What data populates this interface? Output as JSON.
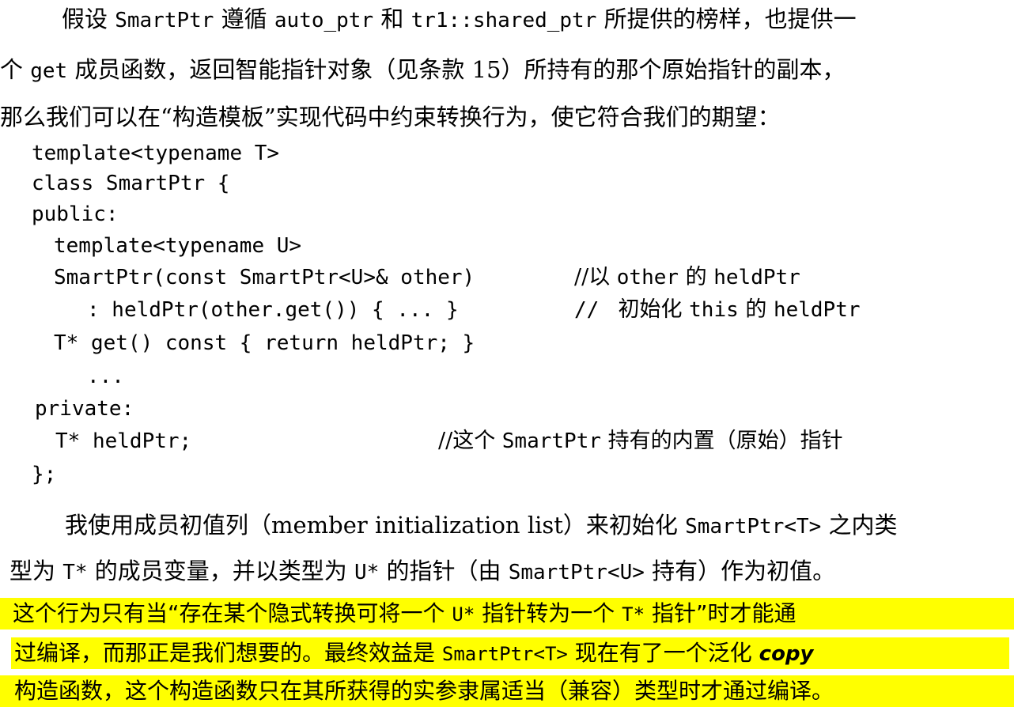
{
  "para1": {
    "l1_a": "假设 ",
    "l1_b": "SmartPtr",
    "l1_c": " 遵循 ",
    "l1_d": "auto_ptr",
    "l1_e": " 和 ",
    "l1_f": "tr1::shared_ptr",
    "l1_g": " 所提供的榜样，也提供一",
    "l2_a": "个 ",
    "l2_b": "get",
    "l2_c": " 成员函数，返回智能指针对象（见条款 15）所持有的那个原始指针的副本，",
    "l3": "那么我们可以在“构造模板”实现代码中约束转换行为，使它符合我们的期望："
  },
  "code": {
    "c1": "template<typename T>",
    "c2": "class SmartPtr {",
    "c3": "public:",
    "c4": "template<typename U>",
    "c5": "SmartPtr(const SmartPtr<U>& other)",
    "c5_cmt_a": "//以 ",
    "c5_cmt_b": "other",
    "c5_cmt_c": " 的 ",
    "c5_cmt_d": "heldPtr",
    "c6": ": heldPtr(other.get()) { ... }",
    "c6_cmt_a": "// ",
    "c6_cmt_b": " 初始化 ",
    "c6_cmt_c": "this",
    "c6_cmt_d": " 的 ",
    "c6_cmt_e": "heldPtr",
    "c7": "T* get() const { return heldPtr; }",
    "c8": "...",
    "c9": "private:",
    "c10": "T* heldPtr;",
    "c10_cmt_a": "//这个 ",
    "c10_cmt_b": "SmartPtr",
    "c10_cmt_c": " 持有的内置（原始）指针",
    "c11": "};"
  },
  "para2": {
    "l1_a": "我使用成员初值列（member initialization list）来初始化 ",
    "l1_b": "SmartPtr<T>",
    "l1_c": " 之内类",
    "l2_a": "型为 ",
    "l2_b": "T*",
    "l2_c": " 的成员变量，并以类型为 ",
    "l2_d": "U*",
    "l2_e": " 的指针（由 ",
    "l2_f": "SmartPtr<U>",
    "l2_g": " 持有）作为初值。",
    "l3_a": "这个行为只有当“存在某个隐式转换可将一个 ",
    "l3_b": "U*",
    "l3_c": " 指针转为一个 ",
    "l3_d": "T*",
    "l3_e": " 指针”时才能通",
    "l4_a": "过编译，而那正是我们想要的。最终效益是 ",
    "l4_b": "SmartPtr<T>",
    "l4_c": " 现在有了一个泛化 ",
    "l4_d": "copy",
    "l5": "构造函数，这个构造函数只在其所获得的实参隶属适当（兼容）类型时才通过编译。"
  },
  "colors": {
    "highlight": "#ffff00",
    "text": "#000000",
    "background": "#ffffff"
  }
}
